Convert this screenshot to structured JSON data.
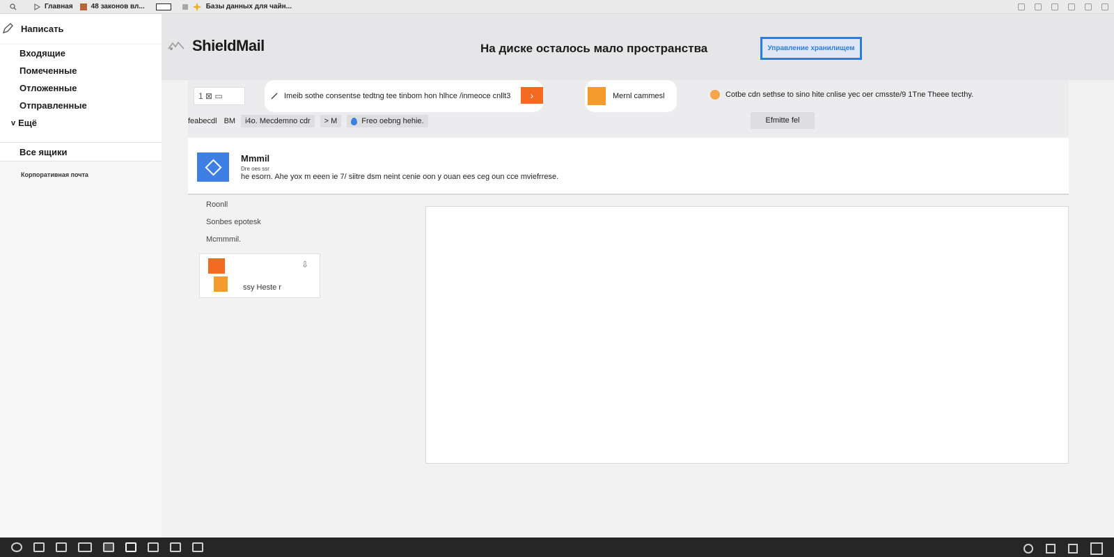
{
  "browser": {
    "bookmarks": [
      {
        "label": "Главная"
      },
      {
        "label": "48 законов вл..."
      },
      {
        "label": ""
      },
      {
        "label": "Базы данных для чайн..."
      }
    ]
  },
  "sidebar": {
    "compose_label": "Написать",
    "items": [
      {
        "label": "Входящие"
      },
      {
        "label": "Помеченные"
      },
      {
        "label": "Отложенные"
      },
      {
        "label": "Отправленные"
      }
    ],
    "more_label": "Ещё",
    "all_boxes_label": "Все ящики",
    "corporate_label": "Корпоративная почта"
  },
  "header": {
    "app_name": "ShieldMail",
    "storage_message": "На диске осталось мало пространства",
    "storage_button": "Управление хранилищем"
  },
  "toolbar": {
    "left_icons_text": "1 ⊠ ▭",
    "pill_a_text": "Imeib sothe consentse tedtng tee tinbom hon hlhce /inmeoce cnllt3",
    "pill_b_text": "Mernl cammesl",
    "promo_text": "Cotbe cdn sethse to sino hite cnlise yec oer cmsste/9 1Tne Theee tecthy.",
    "filter": {
      "label1": "feabecdl",
      "label2": "BM",
      "chip1": "i4o. Mecdemno cdr",
      "chip2": "> M",
      "chip3": "Freo oebng hehie."
    },
    "filter_button": "Efmitte fel"
  },
  "message": {
    "title": "Mmmil",
    "subtitle": "Dre oes ssr",
    "body": "he esorn. Ahe yox m eeen ie 7/ siitre dsm neint cenie oon y ouan ees ceg oun cce mviefrrese."
  },
  "lower_list": {
    "items": [
      "Roonll",
      "Sonbes epotesk",
      "Mcmmmil."
    ],
    "card_text": "ssy Heste r"
  },
  "colors": {
    "accent_blue": "#2a7de1",
    "accent_orange": "#f26b21"
  }
}
